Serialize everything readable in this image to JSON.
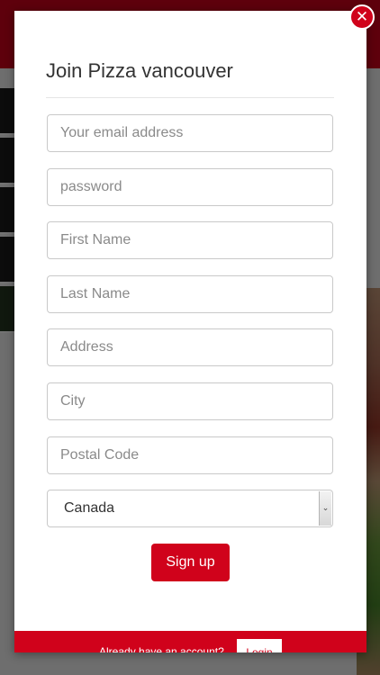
{
  "modal": {
    "title": "Join Pizza vancouver",
    "close_glyph": "✕",
    "fields": [
      {
        "placeholder": "Your email address",
        "value": ""
      },
      {
        "placeholder": "password",
        "value": ""
      },
      {
        "placeholder": "First Name",
        "value": ""
      },
      {
        "placeholder": "Last Name",
        "value": ""
      },
      {
        "placeholder": "Address",
        "value": ""
      },
      {
        "placeholder": "City",
        "value": ""
      },
      {
        "placeholder": "Postal Code",
        "value": ""
      }
    ],
    "country": {
      "selected": "Canada",
      "arrow_glyph": "⌄"
    },
    "signup_label": "Sign up",
    "footer": {
      "text": "Already have an account?",
      "login_label": "Login"
    }
  },
  "colors": {
    "brand_red": "#d0021b",
    "overlay": "rgba(0,0,0,0.55)",
    "field_border": "#c9c9c9",
    "title_text": "#333333"
  },
  "icons": {
    "close": "close-icon",
    "select_arrow": "chevron-down-icon"
  }
}
